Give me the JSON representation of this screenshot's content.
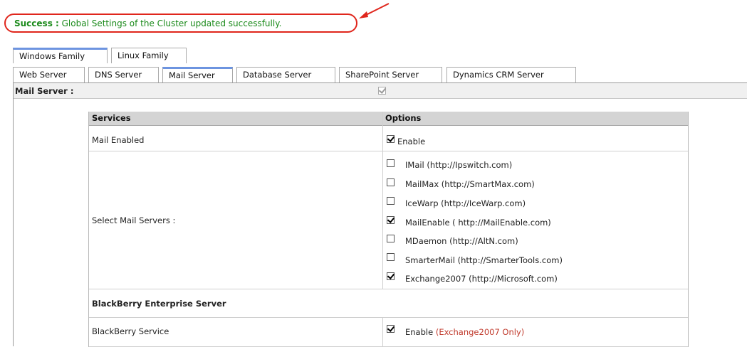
{
  "banner": {
    "label": "Success :",
    "message": " Global Settings of the Cluster updated successfully."
  },
  "family_tabs": [
    {
      "label": "Windows Family",
      "active": true
    },
    {
      "label": "Linux Family",
      "active": false
    }
  ],
  "server_tabs": [
    {
      "label": "Web Server",
      "active": false
    },
    {
      "label": "DNS Server",
      "active": false
    },
    {
      "label": "Mail Server",
      "active": true
    },
    {
      "label": "Database Server",
      "active": false
    },
    {
      "label": "SharePoint Server",
      "active": false
    },
    {
      "label": "Dynamics CRM Server",
      "active": false
    }
  ],
  "mail_server": {
    "label": "Mail Server :",
    "checked": true
  },
  "table": {
    "col_services": "Services",
    "col_options": "Options",
    "mail_enabled": {
      "label": "Mail Enabled",
      "option": "Enable",
      "checked": true
    },
    "select_mail_servers": {
      "label": "Select Mail Servers :",
      "servers": [
        {
          "label": "IMail (http://Ipswitch.com)",
          "checked": false
        },
        {
          "label": "MailMax (http://SmartMax.com)",
          "checked": false
        },
        {
          "label": "IceWarp (http://IceWarp.com)",
          "checked": false
        },
        {
          "label": "MailEnable ( http://MailEnable.com)",
          "checked": true
        },
        {
          "label": "MDaemon (http://AltN.com)",
          "checked": false
        },
        {
          "label": "SmarterMail (http://SmarterTools.com)",
          "checked": false
        },
        {
          "label": "Exchange2007 (http://Microsoft.com)",
          "checked": true
        }
      ]
    },
    "blackberry_section": "BlackBerry Enterprise Server",
    "blackberry_service": {
      "label": "BlackBerry Service",
      "option": "Enable",
      "note": "(Exchange2007 Only)",
      "checked": true
    }
  },
  "colors": {
    "success": "#1a8a1a",
    "highlight": "#e0261c",
    "tab_accent": "#6d94e0",
    "note": "#c0392b"
  }
}
